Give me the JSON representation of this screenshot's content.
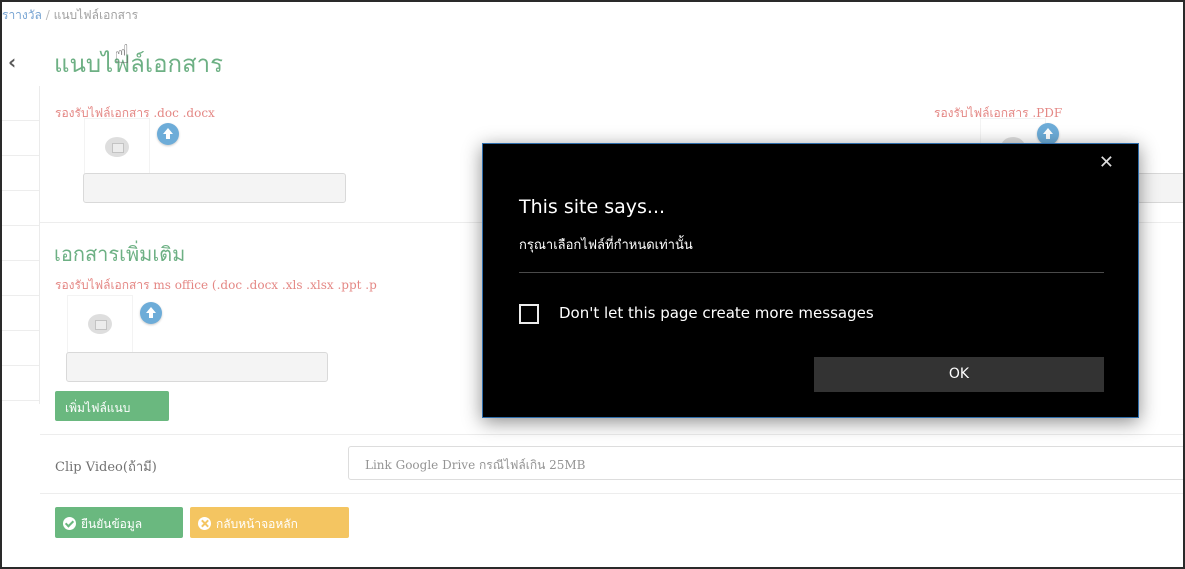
{
  "breadcrumb": {
    "parent": "ราางวัล",
    "separator": "/",
    "current": "แนบไฟล์เอกสาร"
  },
  "page": {
    "title": "แนบไฟล์เอกสาร"
  },
  "uploads": {
    "doc_hint": "รองรับไฟล์เอกสาร .doc .docx",
    "pdf_hint": "รองรับไฟล์เอกสาร .PDF"
  },
  "additional": {
    "title": "เอกสารเพิ่มเติม",
    "hint": "รองรับไฟล์เอกสาร ms office (.doc .docx .xls .xlsx .ppt .p",
    "add_button": "เพิ่มไฟล์แนบ"
  },
  "clip": {
    "label": "Clip Video(ถ้ามี)",
    "placeholder": "Link Google Drive กรณีไฟล์เกิน 25MB"
  },
  "actions": {
    "confirm": "ยืนยันข้อมูล",
    "back": "กลับหน้าจอหลัก"
  },
  "dialog": {
    "close": "✕",
    "title": "This site says...",
    "message": "กรุณาเลือกไฟล์ที่กำหนดเท่านั้น",
    "checkbox_label": "Don't let this page create more messages",
    "ok": "OK"
  },
  "colors": {
    "title_green": "#2f8f4f",
    "hint_red": "#d9534f",
    "button_green": "#2a9a48",
    "button_yellow": "#f0ad1e",
    "dialog_bg": "#000000",
    "dialog_border": "#2e6dab"
  },
  "icons": {
    "back": "chevron-left-icon",
    "cursor": "hand-pointer-icon",
    "upload": "upload-icon",
    "image_placeholder": "image-placeholder-icon",
    "confirm": "check-circle-icon",
    "back_button": "x-circle-icon",
    "close": "close-icon"
  }
}
